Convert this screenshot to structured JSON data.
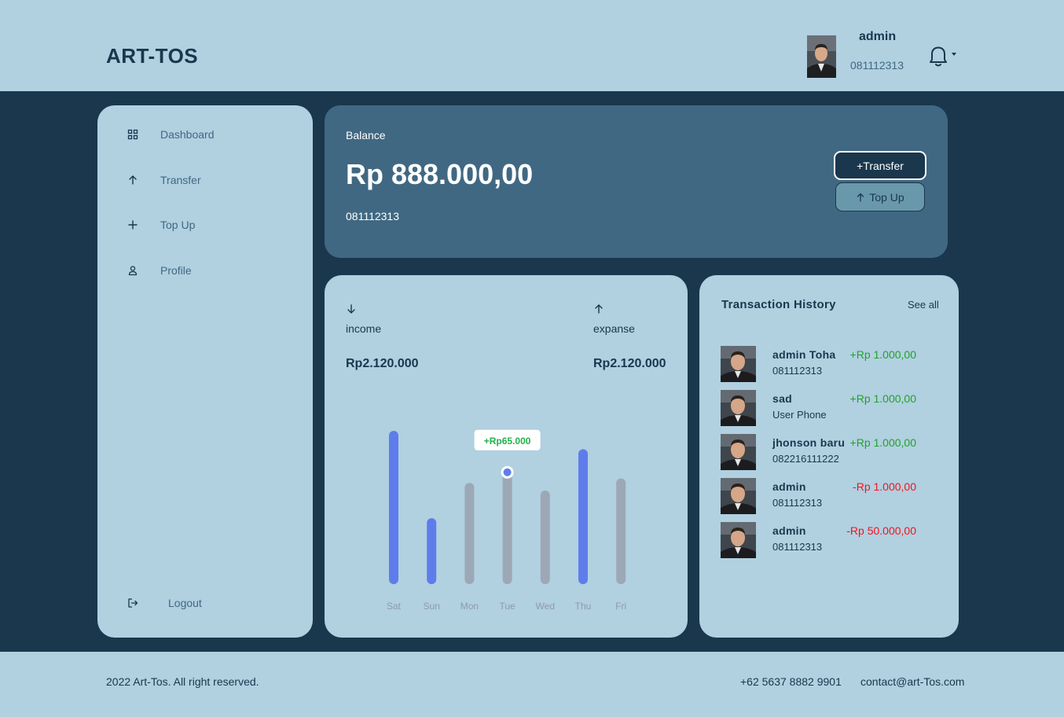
{
  "header": {
    "logo": "ART-TOS",
    "user": {
      "name": "admin",
      "phone": "081112313"
    }
  },
  "sidebar": {
    "items": [
      {
        "label": "Dashboard",
        "icon": "grid-icon"
      },
      {
        "label": "Transfer",
        "icon": "arrow-up-icon"
      },
      {
        "label": "Top Up",
        "icon": "plus-icon"
      },
      {
        "label": "Profile",
        "icon": "user-icon"
      }
    ],
    "logout_label": "Logout"
  },
  "balance": {
    "label": "Balance",
    "amount": "Rp 888.000,00",
    "phone": "081112313",
    "transfer_label": "+Transfer",
    "topup_label": "Top Up"
  },
  "stats": {
    "income_label": "income",
    "income_value": "Rp2.120.000",
    "expense_label": "expanse",
    "expense_value": "Rp2.120.000"
  },
  "chart_data": {
    "type": "bar",
    "categories": [
      "Sat",
      "Sun",
      "Mon",
      "Tue",
      "Wed",
      "Thu",
      "Fri"
    ],
    "values": [
      100,
      43,
      66,
      75,
      61,
      88,
      69
    ],
    "highlighted": [
      true,
      true,
      false,
      false,
      false,
      true,
      false
    ],
    "tooltip": {
      "category": "Tue",
      "label": "+Rp65.000"
    },
    "ylim": [
      0,
      100
    ],
    "colors": {
      "highlight": "#5f7dea",
      "normal": "#9da8b7",
      "tooltip_text": "#22b14c"
    },
    "grid": false,
    "legend": "none"
  },
  "history": {
    "title": "Transaction History",
    "see_all": "See all",
    "items": [
      {
        "name": "admin Toha",
        "sub": "081112313",
        "amount": "+Rp 1.000,00",
        "positive": true
      },
      {
        "name": "sad",
        "sub": "User Phone",
        "amount": "+Rp 1.000,00",
        "positive": true
      },
      {
        "name": "jhonson baru",
        "sub": "082216111222",
        "amount": "+Rp 1.000,00",
        "positive": true
      },
      {
        "name": "admin",
        "sub": "081112313",
        "amount": "-Rp 1.000,00",
        "positive": false
      },
      {
        "name": "admin",
        "sub": "081112313",
        "amount": "-Rp 50.000,00",
        "positive": false
      }
    ]
  },
  "footer": {
    "copyright": "2022 Art-Tos. All right reserved.",
    "phone": "+62 5637 8882 9901",
    "email": "contact@art-Tos.com"
  },
  "colors": {
    "navy": "#1a374d",
    "steel": "#406882",
    "light": "#b1d0e0",
    "teal": "#6998ab",
    "positive": "#22a12a",
    "negative": "#f0141e"
  }
}
